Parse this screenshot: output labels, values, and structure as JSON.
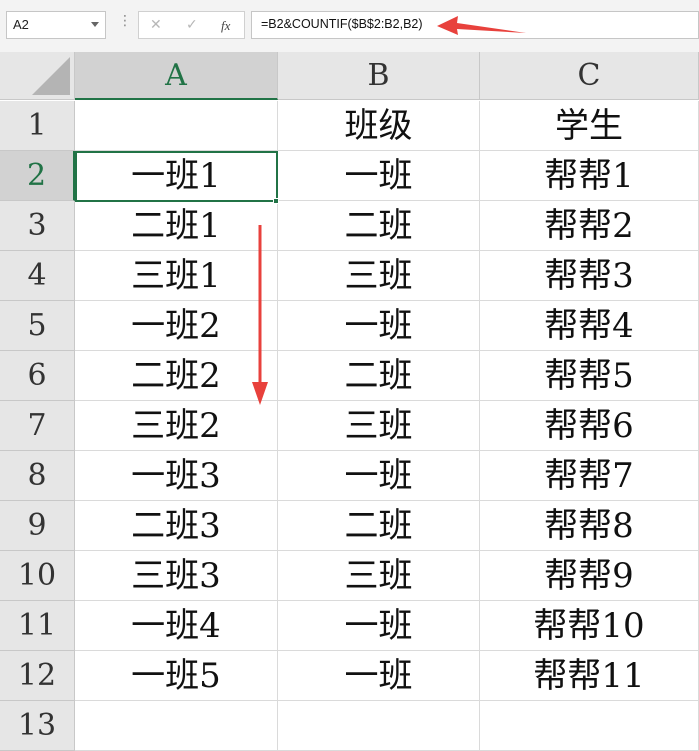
{
  "formula_bar": {
    "name_box": "A2",
    "cancel_icon": "✕",
    "enter_icon": "✓",
    "function_icon": "fx",
    "formula": "=B2&COUNTIF($B$2:B2,B2)"
  },
  "columns": [
    "A",
    "B",
    "C"
  ],
  "rows": [
    {
      "num": "1",
      "a": "",
      "b": "班级",
      "c": "学生"
    },
    {
      "num": "2",
      "a": "一班1",
      "b": "一班",
      "c": "帮帮1"
    },
    {
      "num": "3",
      "a": "二班1",
      "b": "二班",
      "c": "帮帮2"
    },
    {
      "num": "4",
      "a": "三班1",
      "b": "三班",
      "c": "帮帮3"
    },
    {
      "num": "5",
      "a": "一班2",
      "b": "一班",
      "c": "帮帮4"
    },
    {
      "num": "6",
      "a": "二班2",
      "b": "二班",
      "c": "帮帮5"
    },
    {
      "num": "7",
      "a": "三班2",
      "b": "三班",
      "c": "帮帮6"
    },
    {
      "num": "8",
      "a": "一班3",
      "b": "一班",
      "c": "帮帮7"
    },
    {
      "num": "9",
      "a": "二班3",
      "b": "二班",
      "c": "帮帮8"
    },
    {
      "num": "10",
      "a": "三班3",
      "b": "三班",
      "c": "帮帮9"
    },
    {
      "num": "11",
      "a": "一班4",
      "b": "一班",
      "c": "帮帮10"
    },
    {
      "num": "12",
      "a": "一班5",
      "b": "一班",
      "c": "帮帮11"
    },
    {
      "num": "13",
      "a": "",
      "b": "",
      "c": ""
    }
  ],
  "colors": {
    "accent": "#217346",
    "arrow": "#e8413c"
  }
}
